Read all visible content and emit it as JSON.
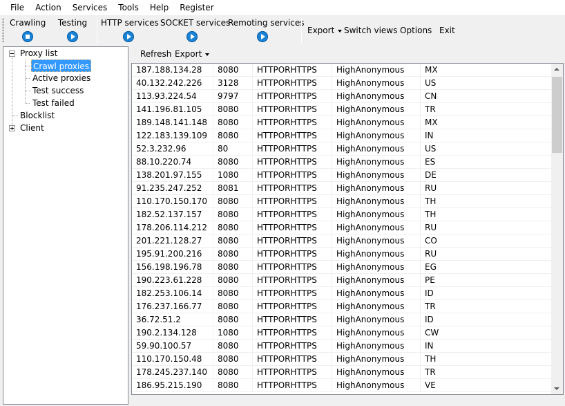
{
  "menu": [
    "File",
    "Action",
    "Services",
    "Tools",
    "Help",
    "Register"
  ],
  "toolbar": {
    "crawling": "Crawling",
    "testing": "Testing",
    "http_services": "HTTP services",
    "socket_services": "SOCKET services",
    "remoting_services": "Remoting services",
    "export": "Export",
    "switch_views": "Switch views",
    "options": "Options",
    "exit": "Exit"
  },
  "tree": {
    "proxy_list": "Proxy list",
    "crawl_proxies": "Crawl proxies",
    "active_proxies": "Active proxies",
    "test_success": "Test success",
    "test_failed": "Test failed",
    "blocklist": "Blocklist",
    "client": "Client"
  },
  "subtoolbar": {
    "refresh": "Refresh",
    "export": "Export"
  },
  "proxies": [
    [
      "187.188.134.28",
      "8080",
      "HTTPORHTTPS",
      "HighAnonymous",
      "MX"
    ],
    [
      "40.132.242.226",
      "3128",
      "HTTPORHTTPS",
      "HighAnonymous",
      "US"
    ],
    [
      "113.93.224.54",
      "9797",
      "HTTPORHTTPS",
      "HighAnonymous",
      "CN"
    ],
    [
      "141.196.81.105",
      "8080",
      "HTTPORHTTPS",
      "HighAnonymous",
      "TR"
    ],
    [
      "189.148.141.148",
      "8080",
      "HTTPORHTTPS",
      "HighAnonymous",
      "MX"
    ],
    [
      "122.183.139.109",
      "8080",
      "HTTPORHTTPS",
      "HighAnonymous",
      "IN"
    ],
    [
      "52.3.232.96",
      "80",
      "HTTPORHTTPS",
      "HighAnonymous",
      "US"
    ],
    [
      "88.10.220.74",
      "8080",
      "HTTPORHTTPS",
      "HighAnonymous",
      "ES"
    ],
    [
      "138.201.97.155",
      "1080",
      "HTTPORHTTPS",
      "HighAnonymous",
      "DE"
    ],
    [
      "91.235.247.252",
      "8081",
      "HTTPORHTTPS",
      "HighAnonymous",
      "RU"
    ],
    [
      "110.170.150.170",
      "8080",
      "HTTPORHTTPS",
      "HighAnonymous",
      "TH"
    ],
    [
      "182.52.137.157",
      "8080",
      "HTTPORHTTPS",
      "HighAnonymous",
      "TH"
    ],
    [
      "178.206.114.212",
      "8080",
      "HTTPORHTTPS",
      "HighAnonymous",
      "RU"
    ],
    [
      "201.221.128.27",
      "8080",
      "HTTPORHTTPS",
      "HighAnonymous",
      "CO"
    ],
    [
      "195.91.200.216",
      "8080",
      "HTTPORHTTPS",
      "HighAnonymous",
      "RU"
    ],
    [
      "156.198.196.78",
      "8080",
      "HTTPORHTTPS",
      "HighAnonymous",
      "EG"
    ],
    [
      "190.223.61.228",
      "8080",
      "HTTPORHTTPS",
      "HighAnonymous",
      "PE"
    ],
    [
      "182.253.106.14",
      "8080",
      "HTTPORHTTPS",
      "HighAnonymous",
      "ID"
    ],
    [
      "176.237.166.77",
      "8080",
      "HTTPORHTTPS",
      "HighAnonymous",
      "TR"
    ],
    [
      "36.72.51.2",
      "8080",
      "HTTPORHTTPS",
      "HighAnonymous",
      "ID"
    ],
    [
      "190.2.134.128",
      "1080",
      "HTTPORHTTPS",
      "HighAnonymous",
      "CW"
    ],
    [
      "59.90.100.57",
      "8080",
      "HTTPORHTTPS",
      "HighAnonymous",
      "IN"
    ],
    [
      "110.170.150.48",
      "8080",
      "HTTPORHTTPS",
      "HighAnonymous",
      "TH"
    ],
    [
      "178.245.237.140",
      "8080",
      "HTTPORHTTPS",
      "HighAnonymous",
      "TR"
    ],
    [
      "186.95.215.190",
      "8080",
      "HTTPORHTTPS",
      "HighAnonymous",
      "VE"
    ]
  ],
  "colors": {
    "selection": "#3399ff",
    "play_button": "#1a82d4",
    "grid_border": "#828790"
  }
}
